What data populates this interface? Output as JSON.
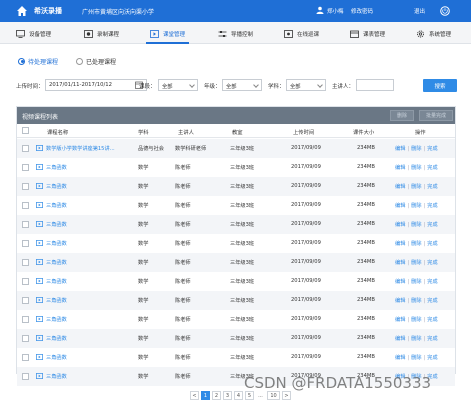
{
  "header": {
    "app_name": "希沃录播",
    "school": "广州市黄埔区向沃向渠小学",
    "user": "郑小梅",
    "change_password": "修改密码",
    "logout": "退出"
  },
  "nav": [
    {
      "label": "设备管理",
      "icon": "monitor-icon"
    },
    {
      "label": "录制课程",
      "icon": "record-icon"
    },
    {
      "label": "课堂管理",
      "icon": "classroom-play-icon",
      "active": true
    },
    {
      "label": "导播控制",
      "icon": "sliders-icon"
    },
    {
      "label": "在线巡课",
      "icon": "eye-icon"
    },
    {
      "label": "课表管理",
      "icon": "calendar-icon"
    },
    {
      "label": "系统管理",
      "icon": "gear-icon"
    }
  ],
  "tabs": {
    "pending": "待处理课程",
    "done": "已处理课程"
  },
  "filters": {
    "date_label": "上传时间：",
    "date_value": "2017/01/11-2017/10/12",
    "subject_label": "课段：",
    "subject_value": "全部",
    "grade_label": "年级：",
    "grade_value": "全部",
    "course_label": "学科：",
    "course_value": "全部",
    "teacher_label": "主讲人：",
    "teacher_value": "",
    "search_button": "搜索"
  },
  "panel": {
    "title": "视频课程列表",
    "delete_button": "删除",
    "batch_button": "批量完成"
  },
  "table": {
    "columns": [
      "课程名称",
      "学科",
      "主讲人",
      "教室",
      "上传时间",
      "课件大小",
      "操作"
    ],
    "rows": [
      {
        "name": "数学版小学数学讲座第15讲...",
        "subject": "品德与社会",
        "teacher": "数学科研老师",
        "room": "三年级3班",
        "date": "2017/09/09",
        "size": "234MB"
      },
      {
        "name": "三角函数",
        "subject": "数学",
        "teacher": "陈老师",
        "room": "三年级3班",
        "date": "2017/09/09",
        "size": "234MB"
      },
      {
        "name": "三角函数",
        "subject": "数学",
        "teacher": "陈老师",
        "room": "三年级3班",
        "date": "2017/09/09",
        "size": "234MB"
      },
      {
        "name": "三角函数",
        "subject": "数学",
        "teacher": "陈老师",
        "room": "三年级3班",
        "date": "2017/09/09",
        "size": "234MB"
      },
      {
        "name": "三角函数",
        "subject": "数学",
        "teacher": "陈老师",
        "room": "三年级3班",
        "date": "2017/09/09",
        "size": "234MB"
      },
      {
        "name": "三角函数",
        "subject": "数学",
        "teacher": "陈老师",
        "room": "三年级3班",
        "date": "2017/09/09",
        "size": "234MB"
      },
      {
        "name": "三角函数",
        "subject": "数学",
        "teacher": "陈老师",
        "room": "三年级3班",
        "date": "2017/09/09",
        "size": "234MB"
      },
      {
        "name": "三角函数",
        "subject": "数学",
        "teacher": "陈老师",
        "room": "三年级3班",
        "date": "2017/09/09",
        "size": "234MB"
      },
      {
        "name": "三角函数",
        "subject": "数学",
        "teacher": "陈老师",
        "room": "三年级3班",
        "date": "2017/09/09",
        "size": "234MB"
      },
      {
        "name": "三角函数",
        "subject": "数学",
        "teacher": "陈老师",
        "room": "三年级3班",
        "date": "2017/09/09",
        "size": "234MB"
      },
      {
        "name": "三角函数",
        "subject": "数学",
        "teacher": "陈老师",
        "room": "三年级3班",
        "date": "2017/09/09",
        "size": "234MB"
      },
      {
        "name": "三角函数",
        "subject": "数学",
        "teacher": "陈老师",
        "room": "三年级3班",
        "date": "2017/09/09",
        "size": "234MB"
      },
      {
        "name": "三角函数",
        "subject": "数学",
        "teacher": "陈老师",
        "room": "三年级3班",
        "date": "2017/09/09",
        "size": "234MB"
      }
    ],
    "ops": {
      "edit": "编辑",
      "delete": "删除",
      "finish": "完成"
    }
  },
  "pagination": {
    "prev": "<",
    "pages": [
      "1",
      "2",
      "3",
      "4",
      "5",
      "...",
      "10"
    ],
    "next": ">",
    "current": "1"
  },
  "watermark": "CSDN @FRDATA1550333",
  "colors": {
    "brand_blue": "#1f6fd6",
    "link_blue": "#2f8be6",
    "panel_head": "#6a7785"
  }
}
